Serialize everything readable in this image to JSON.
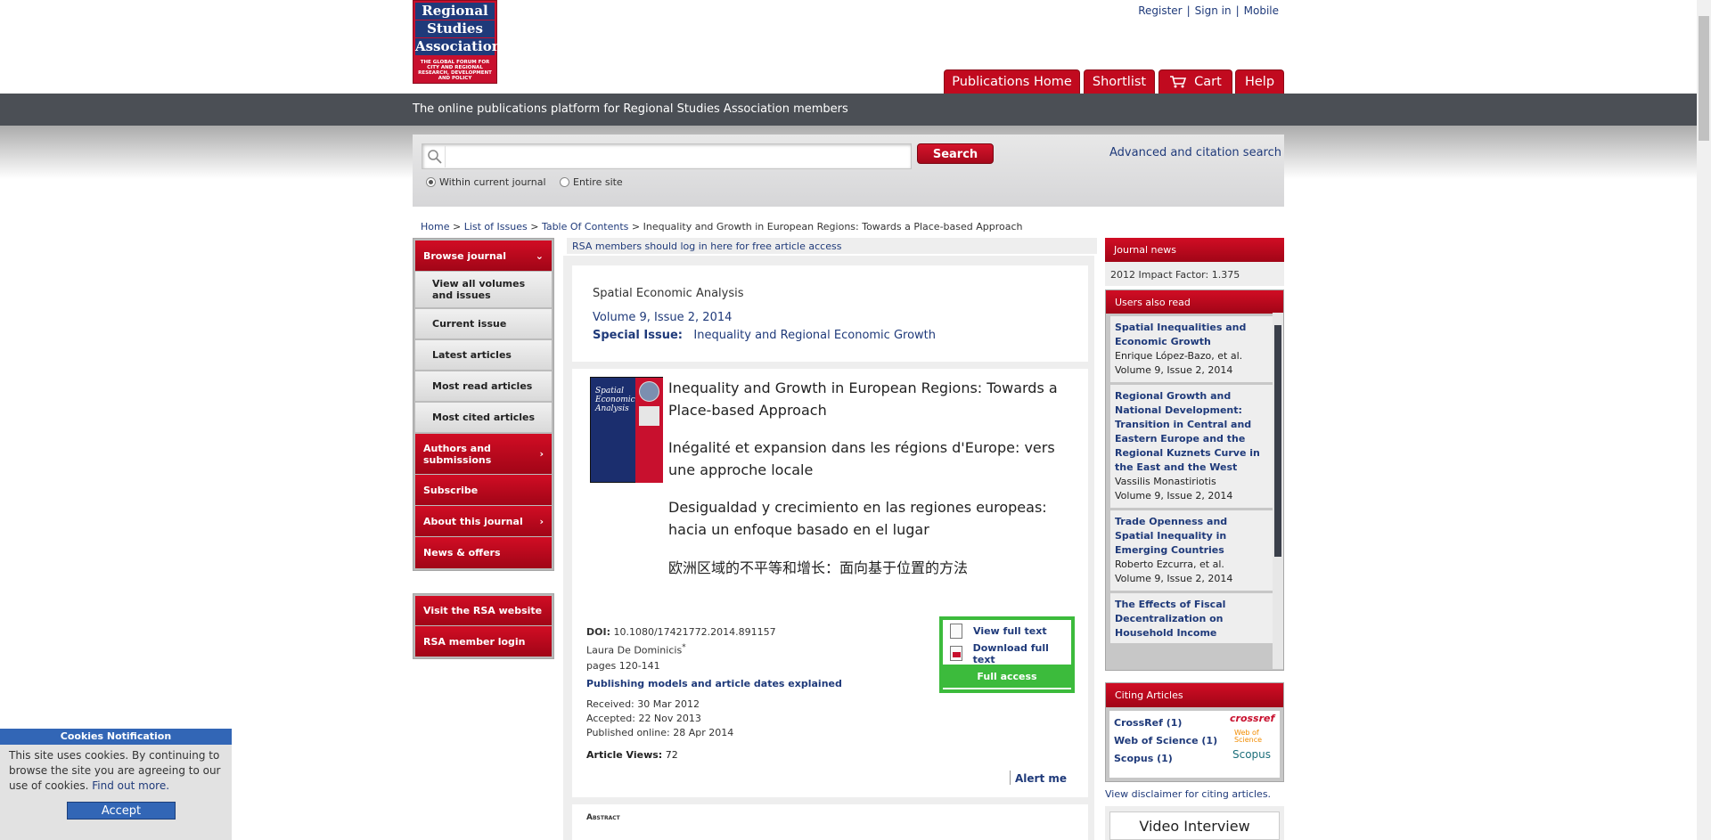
{
  "logo": {
    "line1": "Regional",
    "line2": "Studies",
    "line3": "Association",
    "tagline": "THE GLOBAL FORUM FOR CITY AND REGIONAL RESEARCH, DEVELOPMENT AND POLICY"
  },
  "top_links": {
    "register": "Register",
    "signin": "Sign in",
    "mobile": "Mobile"
  },
  "nav_tabs": {
    "home": "Publications Home",
    "shortlist": "Shortlist",
    "cart": "Cart",
    "help": "Help"
  },
  "tagline_bar": "The online publications platform for Regional Studies Association members",
  "search": {
    "button": "Search",
    "advanced": "Advanced and citation search",
    "scope_current": "Within current journal",
    "scope_site": "Entire site",
    "placeholder": ""
  },
  "breadcrumb": {
    "home": "Home",
    "issues": "List of Issues",
    "toc": "Table Of Contents",
    "current": "Inequality and Growth in European Regions: Towards a Place-based Approach"
  },
  "left_nav": {
    "browse": "Browse journal",
    "view_all": "View all volumes and issues",
    "current": "Current issue",
    "latest": "Latest articles",
    "most_read": "Most read articles",
    "most_cited": "Most cited articles",
    "authors": "Authors and submissions",
    "subscribe": "Subscribe",
    "about": "About this journal",
    "news": "News & offers",
    "visit_rsa": "Visit the RSA website",
    "member_login": "RSA member login"
  },
  "rsa_message": "RSA members should log in here for free article access",
  "journal": {
    "name": "Spatial Economic Analysis",
    "volume": "Volume 9, Issue 2, 2014",
    "special_label": "Special Issue:",
    "special_title": "Inequality and Regional Economic Growth"
  },
  "cover": {
    "title": "Spatial Economic Analysis"
  },
  "article": {
    "title_en": "Inequality and Growth in European Regions: Towards a Place-based Approach",
    "title_fr": "Inégalité et expansion dans les régions d'Europe: vers une approche locale",
    "title_es": "Desigualdad y crecimiento en las regiones europeas: hacia un enfoque basado en el lugar",
    "title_zh": "欧洲区域的不平等和增长：面向基于位置的方法",
    "doi_label": "DOI:",
    "doi": "10.1080/17421772.2014.891157",
    "author": "Laura De Dominicis",
    "author_mark": "*",
    "pages": "pages 120-141",
    "pub_models": "Publishing models and article dates explained",
    "received": "Received: 30 Mar 2012",
    "accepted": "Accepted: 22 Nov 2013",
    "published": "Published online: 28 Apr 2014",
    "views_label": "Article Views:",
    "views": "72",
    "alert": "Alert me",
    "abstract": "Abstract"
  },
  "access": {
    "view": "View full text",
    "download": "Download full text",
    "full": "Full access"
  },
  "right": {
    "journal_news": "Journal news",
    "impact": "2012 Impact Factor: 1.375",
    "users_also_read": "Users also read",
    "items": [
      {
        "title": "Spatial Inequalities and Economic Growth",
        "authors": "Enrique López-Bazo, et al.",
        "issue": "Volume 9, Issue 2, 2014"
      },
      {
        "title": "Regional Growth and National Development: Transition in Central and Eastern Europe and the Regional Kuznets Curve in the East and the West",
        "authors": "Vassilis Monastiriotis",
        "issue": "Volume 9, Issue 2, 2014"
      },
      {
        "title": "Trade Openness and Spatial Inequality in Emerging Countries",
        "authors": "Roberto Ezcurra, et al.",
        "issue": "Volume 9, Issue 2, 2014"
      },
      {
        "title": "The Effects of Fiscal Decentralization on Household Income Inequality: Some Empirical Evidence",
        "authors": "",
        "issue": ""
      }
    ],
    "citing_articles": "Citing Articles",
    "crossref": "CrossRef (1)",
    "wos": "Web of Science (1)",
    "scopus": "Scopus (1)",
    "crossref_logo": "crossref",
    "wos_logo": "Web of Science",
    "scopus_logo": "Scopus",
    "disclaimer": "View disclaimer for citing articles.",
    "video": "Video Interview"
  },
  "cookie": {
    "title": "Cookies Notification",
    "text": "This site uses cookies. By continuing to browse the site you are agreeing to our use of cookies.",
    "link": "Find out more.",
    "accept": "Accept"
  },
  "colors": {
    "brand_red": "#c10a1f",
    "brand_blue": "#1f3a7a",
    "access_green": "#3cbb3c",
    "cookie_blue": "#3266b6"
  }
}
